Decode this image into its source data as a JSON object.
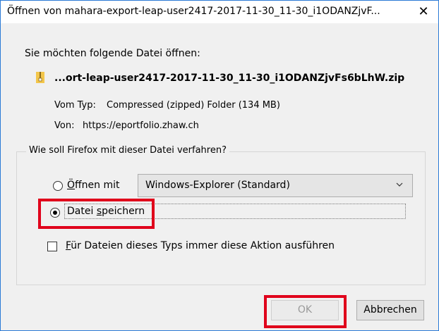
{
  "window": {
    "title": "Öffnen von mahara-export-leap-user2417-2017-11-30_11-30_i1ODANZjvF...",
    "close_glyph": "✕",
    "accent_color": "#2b7ad6"
  },
  "intro_text": "Sie möchten folgende Datei öffnen:",
  "file": {
    "icon": "zip-file-icon",
    "name": "...ort-leap-user2417-2017-11-30_11-30_i1ODANZjvFs6bLhW.zip",
    "type_label": "Vom Typ:",
    "type_value": "Compressed (zipped) Folder (134 MB)",
    "from_label": "Von:",
    "from_value": "https://eportfolio.zhaw.ch"
  },
  "action_group": {
    "legend": "Wie soll Firefox mit dieser Datei verfahren?",
    "open_with": {
      "label_underlined": "Ö",
      "label_rest": "ffnen mit",
      "selected": false
    },
    "app_select": {
      "value": "Windows-Explorer (Standard)"
    },
    "save_file": {
      "label_plain": "Datei ",
      "label_underlined": "s",
      "label_rest": "peichern",
      "selected": true
    },
    "always_action": {
      "label_underlined": "F",
      "label_rest": "ür Dateien dieses Typs immer diese Aktion ausführen",
      "checked": false
    }
  },
  "buttons": {
    "ok_label": "OK",
    "cancel_label": "Abbrechen"
  },
  "highlight_color": "#e0001b"
}
